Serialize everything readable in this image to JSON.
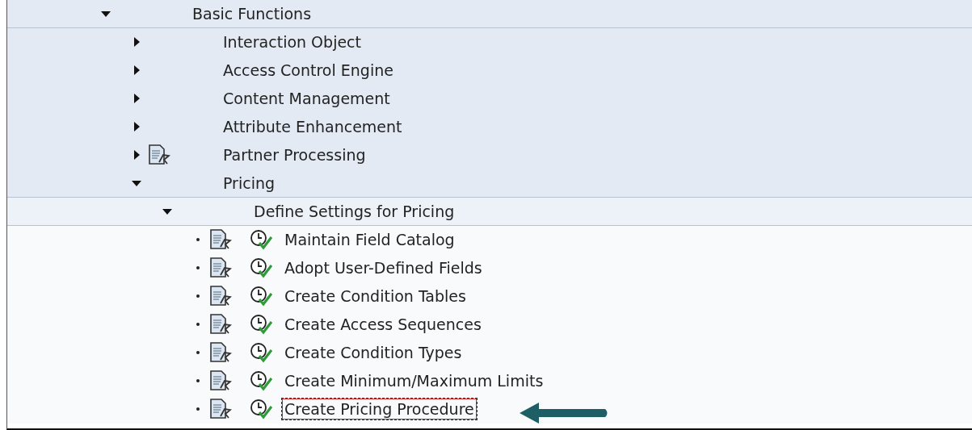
{
  "tree": [
    {
      "kind": "folder",
      "label": "Basic Functions",
      "expanded": true,
      "documentation": false,
      "executable": false,
      "selected": false,
      "children": [
        {
          "kind": "folder",
          "label": "Interaction Object",
          "expanded": false,
          "documentation": false,
          "executable": false,
          "selected": false
        },
        {
          "kind": "folder",
          "label": "Access Control Engine",
          "expanded": false,
          "documentation": false,
          "executable": false,
          "selected": false
        },
        {
          "kind": "folder",
          "label": "Content Management",
          "expanded": false,
          "documentation": false,
          "executable": false,
          "selected": false
        },
        {
          "kind": "folder",
          "label": "Attribute Enhancement",
          "expanded": false,
          "documentation": false,
          "executable": false,
          "selected": false
        },
        {
          "kind": "folder",
          "label": "Partner Processing",
          "expanded": false,
          "documentation": true,
          "executable": false,
          "selected": false
        },
        {
          "kind": "folder",
          "label": "Pricing",
          "expanded": true,
          "documentation": false,
          "executable": false,
          "selected": false,
          "children": [
            {
              "kind": "folder",
              "label": "Define Settings for Pricing",
              "expanded": true,
              "documentation": false,
              "executable": false,
              "selected": false,
              "children": [
                {
                  "kind": "activity",
                  "label": "Maintain Field Catalog",
                  "documentation": true,
                  "executable": true,
                  "selected": false
                },
                {
                  "kind": "activity",
                  "label": "Adopt User-Defined Fields",
                  "documentation": true,
                  "executable": true,
                  "selected": false
                },
                {
                  "kind": "activity",
                  "label": "Create Condition Tables",
                  "documentation": true,
                  "executable": true,
                  "selected": false
                },
                {
                  "kind": "activity",
                  "label": "Create Access Sequences",
                  "documentation": true,
                  "executable": true,
                  "selected": false
                },
                {
                  "kind": "activity",
                  "label": "Create Condition Types",
                  "documentation": true,
                  "executable": true,
                  "selected": false
                },
                {
                  "kind": "activity",
                  "label": "Create Minimum/Maximum Limits",
                  "documentation": true,
                  "executable": true,
                  "selected": false
                },
                {
                  "kind": "activity",
                  "label": "Create Pricing Procedure",
                  "documentation": true,
                  "executable": true,
                  "selected": true
                }
              ]
            }
          ]
        }
      ]
    }
  ]
}
